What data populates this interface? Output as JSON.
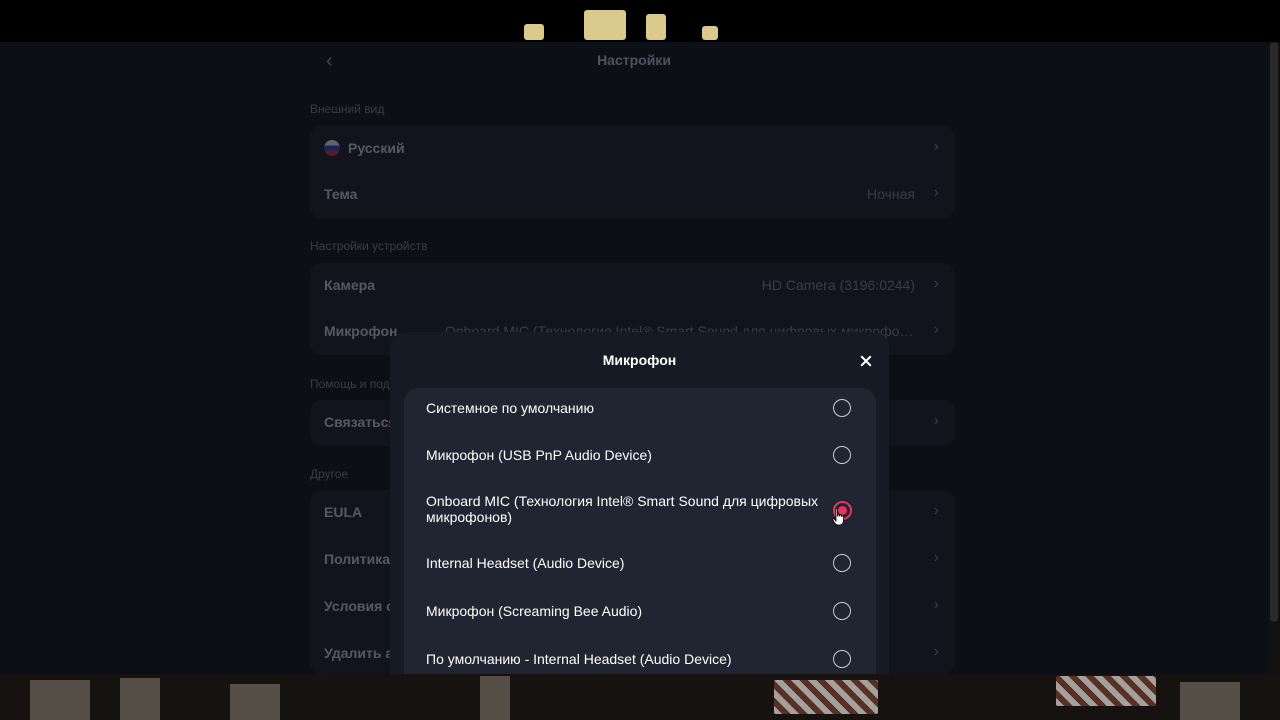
{
  "settings": {
    "title": "Настройки",
    "appearance": {
      "section_label": "Внешний вид",
      "language": "Русский",
      "theme_label": "Тема",
      "theme_value": "Ночная"
    },
    "device": {
      "section_label": "Настройки устройств",
      "camera_label": "Камера",
      "camera_value": "HD Camera (3196:0244)",
      "mic_label": "Микрофон",
      "mic_value": "Onboard MIC (Технология Intel® Smart Sound для цифровых микрофонов)"
    },
    "help": {
      "section_label": "Помощь и под",
      "contact_label": "Связаться"
    },
    "other": {
      "section_label": "Другое",
      "items": [
        "EULA",
        "Политика к",
        "Условия ос",
        "Удалить ак"
      ]
    }
  },
  "modal": {
    "title": "Микрофон",
    "options": [
      {
        "label": "Системное по умолчанию",
        "selected": false
      },
      {
        "label": "Микрофон (USB PnP Audio Device)",
        "selected": false
      },
      {
        "label": "Onboard MIC (Технология Intel® Smart Sound для цифровых микрофонов)",
        "selected": true
      },
      {
        "label": "Internal Headset (Audio Device)",
        "selected": false
      },
      {
        "label": "Микрофон (Screaming Bee Audio)",
        "selected": false
      },
      {
        "label": "По умолчанию - Internal Headset (Audio Device)",
        "selected": false
      }
    ]
  },
  "colors": {
    "accent": "#e8335f",
    "background": "#0d0f17",
    "modal": "#161a24",
    "options_panel": "#212531"
  },
  "icons": {
    "back": "chevron-left-icon",
    "close": "close-icon",
    "row_chevron": "chevron-right-icon",
    "language_flag": "russia-flag-icon"
  }
}
